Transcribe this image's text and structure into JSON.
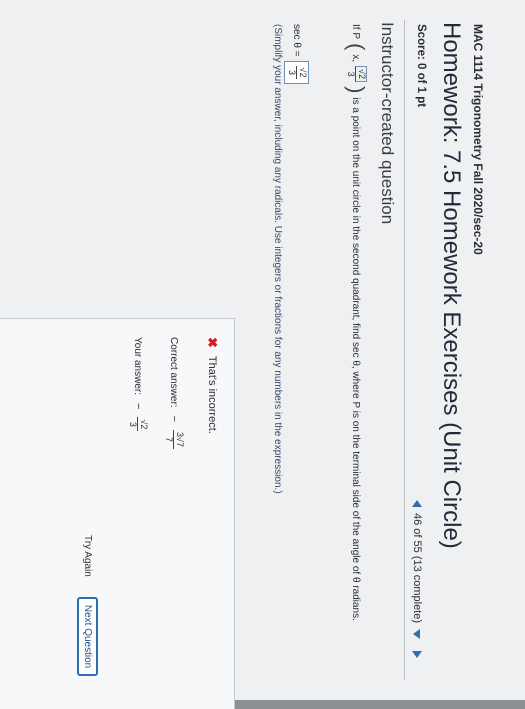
{
  "header": {
    "course": "MAC 1114 Trigonometry Fall 2020/sec-20",
    "title": "Homework: 7.5 Homework Exercises (Unit Circle)",
    "score": "Score: 0 of 1 pt",
    "progress": "46 of 55 (13 complete)"
  },
  "question": {
    "section": "Instructor-created question",
    "prompt_prefix": "If P",
    "prompt_x": "x,",
    "point_y_num": "√2",
    "point_y_den": "3",
    "prompt_suffix": "is a point on the unit circle in the second quadrant, find sec θ, where P is on the terminal side of the angle of θ radians.",
    "answer_label": "sec θ =",
    "answer_num": "√2",
    "answer_den": "3",
    "hint": "(Simplify your answer, including any radicals. Use integers or fractions for any numbers in the expression.)"
  },
  "feedback": {
    "status": "That's incorrect.",
    "correct_label": "Correct answer:",
    "correct_sign": "−",
    "correct_num": "3√7",
    "correct_den": "7",
    "your_label": "Your answer:",
    "your_sign": "−",
    "your_num": "√2",
    "your_den": "3",
    "try_again": "Try Again",
    "next_question": "Next Question"
  }
}
